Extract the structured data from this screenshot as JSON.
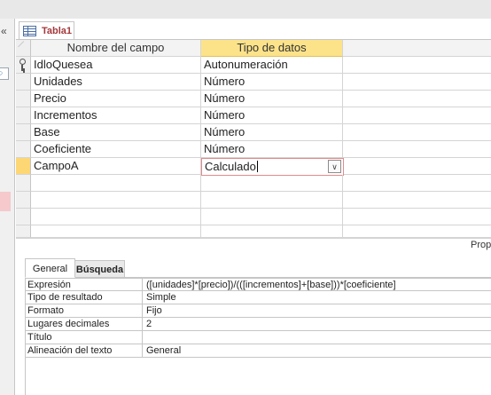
{
  "document_tab": {
    "label": "Tabla1",
    "icon": "table-icon"
  },
  "grid": {
    "headers": {
      "field_name": "Nombre del campo",
      "data_type": "Tipo de datos"
    },
    "rows": [
      {
        "name": "IdloQuesea",
        "type": "Autonumeración",
        "primary_key": true
      },
      {
        "name": "Unidades",
        "type": "Número"
      },
      {
        "name": "Precio",
        "type": "Número"
      },
      {
        "name": "Incrementos",
        "type": "Número"
      },
      {
        "name": "Base",
        "type": "Número"
      },
      {
        "name": "Coeficiente",
        "type": "Número"
      },
      {
        "name": "CampoA",
        "type": "Calculado",
        "active": true
      }
    ],
    "empty_rows": 4
  },
  "properties_label": "Prop",
  "properties": {
    "tabs": [
      {
        "label": "General",
        "active": true
      },
      {
        "label": "Búsqueda",
        "active": false
      }
    ],
    "rows": [
      {
        "key": "Expresión",
        "value": "([unidades]*[precio])/(([incrementos]+[base]))*[coeficiente]"
      },
      {
        "key": "Tipo de resultado",
        "value": "Simple"
      },
      {
        "key": "Formato",
        "value": "Fijo"
      },
      {
        "key": "Lugares decimales",
        "value": "2"
      },
      {
        "key": "Título",
        "value": ""
      },
      {
        "key": "Alineación del texto",
        "value": "General"
      }
    ]
  },
  "colors": {
    "selected_header": "#fce38a",
    "active_row_selector": "#fdd774",
    "tab_text": "#a4373a",
    "focus_border": "#e38a8d"
  }
}
